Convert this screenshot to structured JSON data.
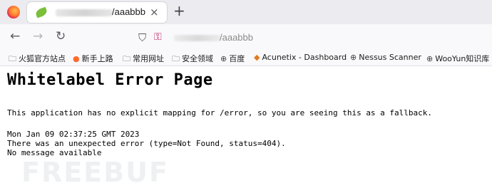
{
  "tab": {
    "title": "/aaabbb",
    "close": "×",
    "new_tab": "+"
  },
  "nav": {
    "back": "←",
    "forward": "→",
    "reload": "↻"
  },
  "address": {
    "shield": "⛉",
    "lock": "⚿",
    "url": "/aaabbb"
  },
  "bookmarks": [
    {
      "icon": "🗀",
      "label": "火狐官方站点"
    },
    {
      "icon": "●",
      "label": "新手上路"
    },
    {
      "icon": "🗀",
      "label": "常用网址"
    },
    {
      "icon": "🗀",
      "label": "安全领域"
    },
    {
      "icon": "⊕",
      "label": "百度"
    },
    {
      "icon": "◆",
      "label": "Acunetix - Dashboard"
    },
    {
      "icon": "⊕",
      "label": "Nessus Scanner"
    },
    {
      "icon": "⊕",
      "label": "WooYun知识库"
    }
  ],
  "page": {
    "title": "Whitelabel Error Page",
    "line1": "This application has no explicit mapping for /error, so you are seeing this as a fallback.",
    "line2": "Mon Jan 09 02:37:25 GMT 2023",
    "line3": "There was an unexpected error (type=Not Found, status=404).",
    "line4": "No message available"
  },
  "watermark": "FREEBUF"
}
